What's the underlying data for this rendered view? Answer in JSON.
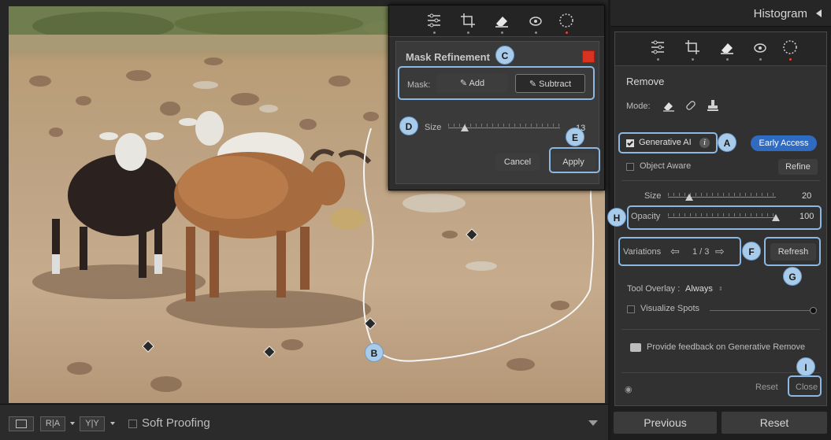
{
  "histogram": {
    "title": "Histogram"
  },
  "mask_refinement": {
    "title": "Mask Refinement",
    "mask_label": "Mask:",
    "add_label": "Add",
    "subtract_label": "Subtract",
    "size_label": "Size",
    "size_value": "13",
    "cancel_label": "Cancel",
    "apply_label": "Apply",
    "size_level": 0.15
  },
  "remove_panel": {
    "title": "Remove",
    "mode_label": "Mode:",
    "generative_ai_label": "Generative AI",
    "early_access_label": "Early Access",
    "object_aware_label": "Object Aware",
    "refine_label": "Refine",
    "size_label": "Size",
    "size_value": "20",
    "opacity_label": "Opacity",
    "opacity_value": "100",
    "variations_label": "Variations",
    "variations_counter": "1 / 3",
    "refresh_label": "Refresh",
    "tool_overlay_label": "Tool Overlay :",
    "tool_overlay_value": "Always",
    "visualize_spots_label": "Visualize Spots",
    "feedback_label": "Provide feedback on Generative Remove",
    "reset_label": "Reset",
    "close_label": "Close",
    "size_level": 0.2,
    "opacity_level": 1.0,
    "visualize_level": 1.0
  },
  "callouts": {
    "a": "A",
    "b": "B",
    "c": "C",
    "d": "D",
    "e": "E",
    "f": "F",
    "g": "G",
    "h": "H",
    "i": "I"
  },
  "bottom_bar": {
    "ra_label": "R|A",
    "yy_label": "Y|Y",
    "soft_proofing_label": "Soft Proofing"
  },
  "footer": {
    "previous_label": "Previous",
    "reset_label": "Reset"
  },
  "colors": {
    "accent_blue": "#2f6bc1",
    "callout_blue": "#a9cbea",
    "active_red": "#e8412c",
    "mask_swatch": "#d9321f"
  }
}
